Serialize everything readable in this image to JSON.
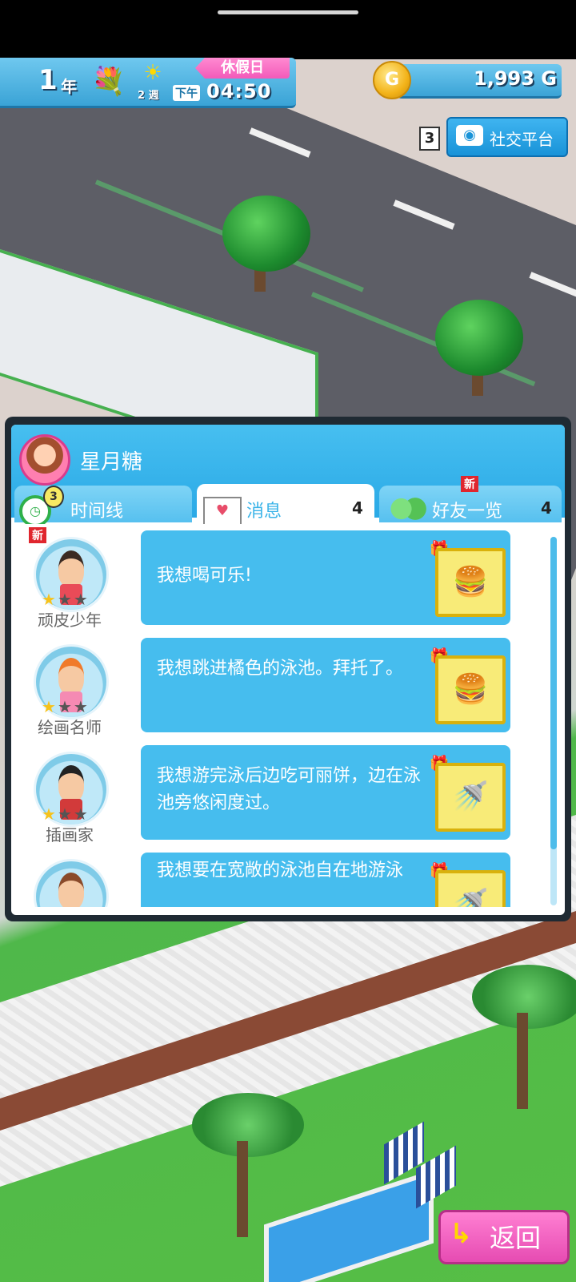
{
  "hud": {
    "year": "1",
    "year_unit": "年",
    "season_icon": "flower-icon",
    "weather_icon": "sun-icon",
    "week": "2 週",
    "holiday": "休假日",
    "ampm": "下午",
    "time": "04:50",
    "money": "1,993 G",
    "coin_icon": "coin-icon",
    "coin_letter": "G"
  },
  "social": {
    "count": "3",
    "label": "社交平台"
  },
  "panel": {
    "profile_name": "星月糖",
    "tabs": {
      "timeline": {
        "label": "时间线",
        "badge": "3"
      },
      "messages": {
        "label": "消息",
        "count": "4"
      },
      "friends": {
        "label": "好友一览",
        "count": "4",
        "new_tag": "新"
      }
    },
    "messages": [
      {
        "name": "顽皮少年",
        "new_tag": "新",
        "stars_on": "★",
        "stars_off": "★★",
        "text": "我想喝可乐!",
        "gift": "🍔"
      },
      {
        "name": "绘画名师",
        "new_tag": "",
        "stars_on": "★",
        "stars_off": "★★",
        "text": "我想跳进橘色的泳池。拜托了。",
        "gift": "🍔"
      },
      {
        "name": "插画家",
        "new_tag": "",
        "stars_on": "★",
        "stars_off": "★★",
        "text": "我想游完泳后边吃可丽饼，边在泳池旁悠闲度过。",
        "gift": "🚿"
      },
      {
        "name": "",
        "new_tag": "",
        "stars_on": "",
        "stars_off": "",
        "text": "我想要在宽敞的泳池自在地游泳",
        "gift": "🚿"
      }
    ]
  },
  "back_button": {
    "label": "返回"
  }
}
